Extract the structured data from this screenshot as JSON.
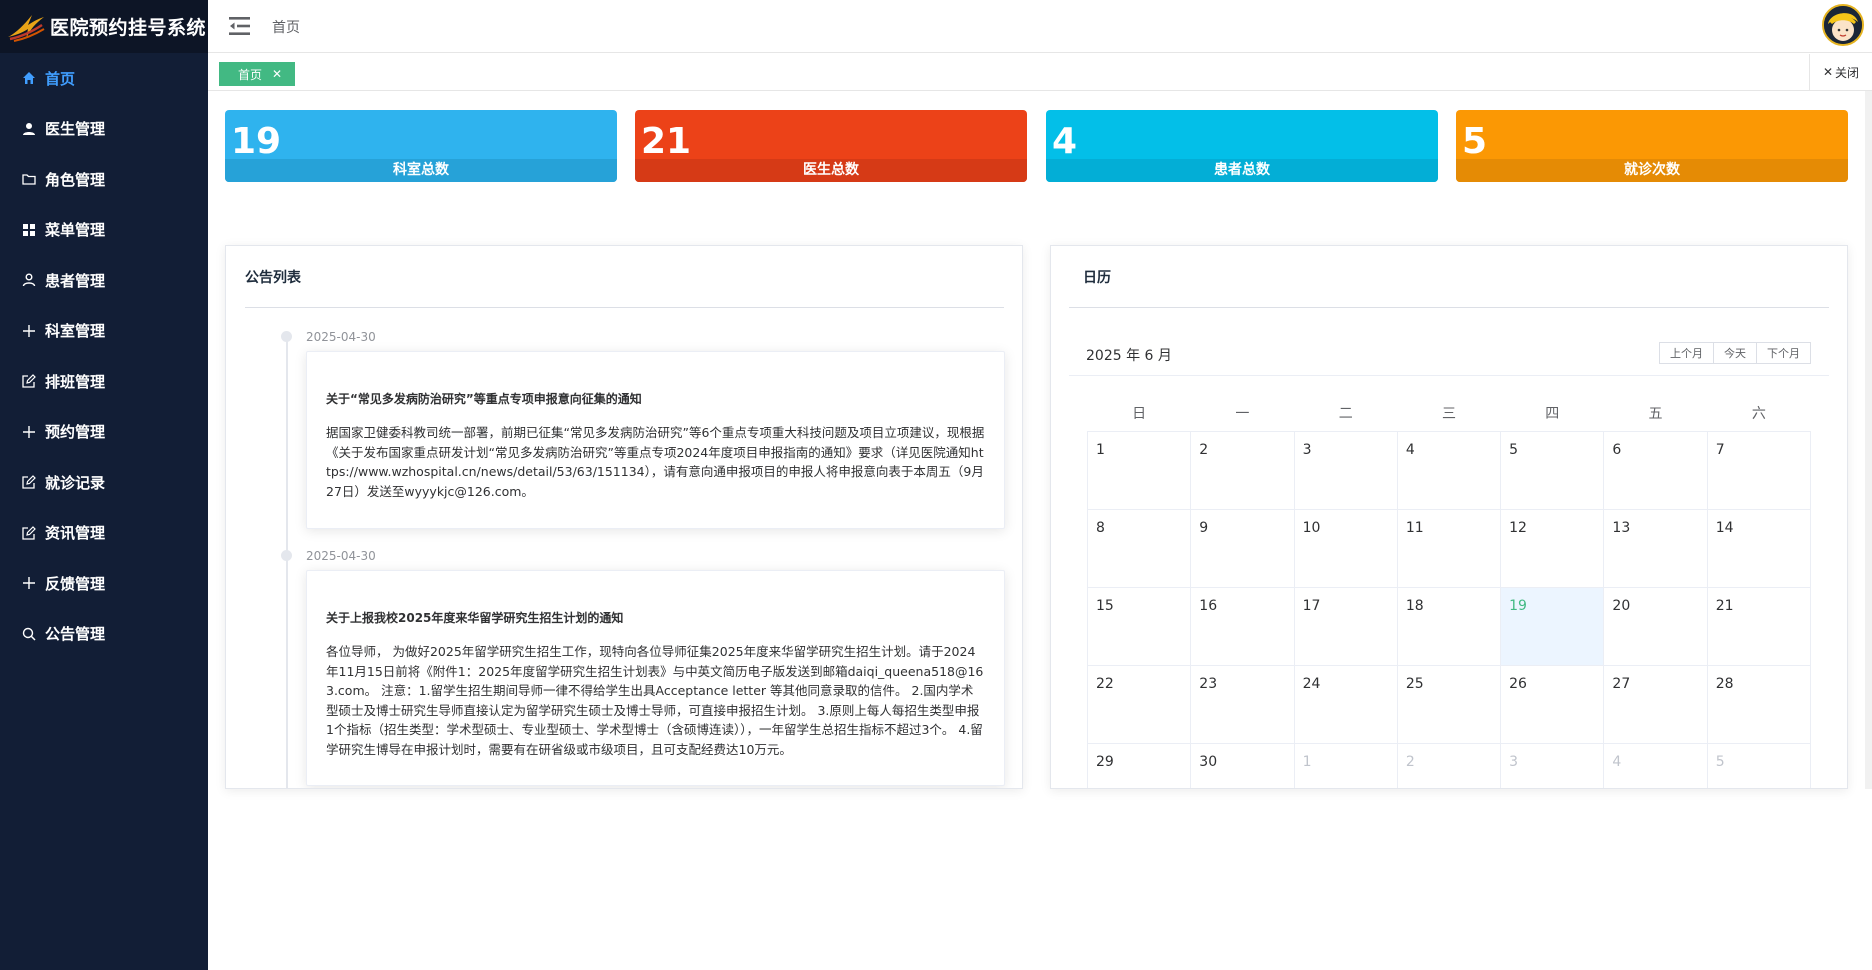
{
  "app": {
    "title": "医院预约挂号系统"
  },
  "sidebar": {
    "items": [
      {
        "label": "首页",
        "icon": "home-icon",
        "active": true
      },
      {
        "label": "医生管理",
        "icon": "user-icon"
      },
      {
        "label": "角色管理",
        "icon": "folder-icon"
      },
      {
        "label": "菜单管理",
        "icon": "grid-icon"
      },
      {
        "label": "患者管理",
        "icon": "user-outline-icon"
      },
      {
        "label": "科室管理",
        "icon": "plus-icon"
      },
      {
        "label": "排班管理",
        "icon": "edit-icon"
      },
      {
        "label": "预约管理",
        "icon": "plus-icon"
      },
      {
        "label": "就诊记录",
        "icon": "edit-icon"
      },
      {
        "label": "资讯管理",
        "icon": "edit-icon"
      },
      {
        "label": "反馈管理",
        "icon": "plus-icon"
      },
      {
        "label": "公告管理",
        "icon": "search-icon"
      }
    ]
  },
  "header": {
    "breadcrumb": "首页"
  },
  "tags": {
    "active_tag": "首页",
    "close_label": "关闭"
  },
  "stats": [
    {
      "value": "19",
      "label": "科室总数",
      "color": "#2fb3ee"
    },
    {
      "value": "21",
      "label": "医生总数",
      "color": "#ec4218"
    },
    {
      "value": "4",
      "label": "患者总数",
      "color": "#03bfe8"
    },
    {
      "value": "5",
      "label": "就诊次数",
      "color": "#fb9804"
    }
  ],
  "notices": {
    "title": "公告列表",
    "items": [
      {
        "date": "2025-04-30",
        "title": "关于“常见多发病防治研究”等重点专项申报意向征集的通知",
        "body": "据国家卫健委科教司统一部署，前期已征集“常见多发病防治研究”等6个重点专项重大科技问题及项目立项建议，现根据《关于发布国家重点研发计划“常见多发病防治研究”等重点专项2024年度项目申报指南的通知》要求（详见医院通知https://www.wzhospital.cn/news/detail/53/63/151134），请有意向通申报项目的申报人将申报意向表于本周五（9月27日）发送至wyyykjc@126.com。"
      },
      {
        "date": "2025-04-30",
        "title": "关于上报我校2025年度来华留学研究生招生计划的通知",
        "body": "各位导师， 为做好2025年留学研究生招生工作，现特向各位导师征集2025年度来华留学研究生招生计划。请于2024年11月15日前将《附件1：2025年度留学研究生招生计划表》与中英文简历电子版发送到邮箱daiqi_queena518@163.com。 注意：1.留学生招生期间导师一律不得给学生出具Acceptance letter 等其他同意录取的信件。 2.国内学术型硕士及博士研究生导师直接认定为留学研究生硕士及博士导师，可直接申报招生计划。 3.原则上每人每招生类型申报1个指标（招生类型：学术型硕士、专业型硕士、学术型博士（含硕博连读）），一年留学生总招生指标不超过3个。 4.留学研究生博导在申报计划时，需要有在研省级或市级项目，且可支配经费达10万元。"
      }
    ]
  },
  "calendar": {
    "title": "日历",
    "month_label": "2025 年 6 月",
    "buttons": {
      "prev": "上个月",
      "today": "今天",
      "next": "下个月"
    },
    "weekdays": [
      "日",
      "一",
      "二",
      "三",
      "四",
      "五",
      "六"
    ],
    "weeks": [
      [
        "1",
        "2",
        "3",
        "4",
        "5",
        "6",
        "7"
      ],
      [
        "8",
        "9",
        "10",
        "11",
        "12",
        "13",
        "14"
      ],
      [
        "15",
        "16",
        "17",
        "18",
        "19",
        "20",
        "21"
      ],
      [
        "22",
        "23",
        "24",
        "25",
        "26",
        "27",
        "28"
      ],
      [
        "29",
        "30",
        "1",
        "2",
        "3",
        "4",
        "5"
      ]
    ],
    "today": "19",
    "accent_color": "#42b983"
  }
}
